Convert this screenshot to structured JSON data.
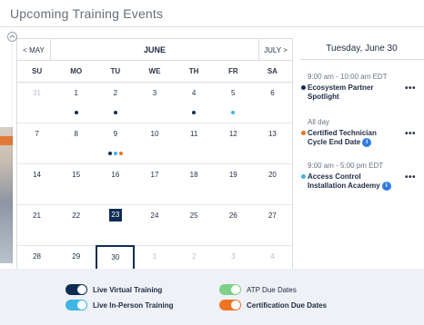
{
  "header": {
    "title": "Upcoming Training Events"
  },
  "calendar": {
    "prev_label": "< MAY",
    "month": "JUNE",
    "next_label": "JULY >",
    "days_of_week": [
      "SU",
      "MO",
      "TU",
      "WE",
      "TH",
      "FR",
      "SA"
    ],
    "weeks": [
      [
        {
          "n": "31",
          "muted": true
        },
        {
          "n": "1",
          "dots": [
            "navy"
          ]
        },
        {
          "n": "2",
          "dots": [
            "navy"
          ]
        },
        {
          "n": "3"
        },
        {
          "n": "4",
          "dots": [
            "navy"
          ]
        },
        {
          "n": "5",
          "dots": [
            "cyan"
          ]
        },
        {
          "n": "6"
        }
      ],
      [
        {
          "n": "7"
        },
        {
          "n": "8"
        },
        {
          "n": "9",
          "dots": [
            "navy",
            "cyan",
            "orange"
          ]
        },
        {
          "n": "10"
        },
        {
          "n": "11"
        },
        {
          "n": "12"
        },
        {
          "n": "13"
        }
      ],
      [
        {
          "n": "14"
        },
        {
          "n": "15"
        },
        {
          "n": "16"
        },
        {
          "n": "17"
        },
        {
          "n": "18"
        },
        {
          "n": "19"
        },
        {
          "n": "20"
        }
      ],
      [
        {
          "n": "21"
        },
        {
          "n": "22"
        },
        {
          "n": "23",
          "today": true
        },
        {
          "n": "24"
        },
        {
          "n": "25"
        },
        {
          "n": "26"
        },
        {
          "n": "27"
        }
      ],
      [
        {
          "n": "28"
        },
        {
          "n": "29"
        },
        {
          "n": "30",
          "selected": true,
          "dots": [
            "navy",
            "cyan"
          ]
        },
        {
          "n": "1",
          "muted": true
        },
        {
          "n": "2",
          "muted": true
        },
        {
          "n": "3",
          "muted": true
        },
        {
          "n": "4",
          "muted": true
        }
      ]
    ]
  },
  "agenda": {
    "date": "Tuesday, June 30",
    "events": [
      {
        "time": "9:00 am - 10:00 am EDT",
        "title": "Ecosystem Partner Spotlight",
        "color": "navy",
        "info": false
      },
      {
        "time": "All day",
        "title": "Certified Technician Cycle End Date",
        "color": "orange",
        "info": true
      },
      {
        "time": "9:00 am - 5:00 pm EDT",
        "title": "Access Control Installation Academy",
        "color": "cyan",
        "info": true
      }
    ],
    "more_glyph": "•••",
    "info_glyph": "i"
  },
  "legend": {
    "items": [
      {
        "label": "Live Virtual Training",
        "color": "navy",
        "bold": true
      },
      {
        "label": "ATP Due Dates",
        "color": "green",
        "bold": false
      },
      {
        "label": "Live In-Person Training",
        "color": "cyan",
        "bold": true
      },
      {
        "label": "Certification Due Dates",
        "color": "orange",
        "bold": true
      }
    ]
  },
  "colors": {
    "navy": "#0f2d52",
    "cyan": "#3fb6e3",
    "orange": "#ee7424",
    "green": "#7fd08a"
  }
}
